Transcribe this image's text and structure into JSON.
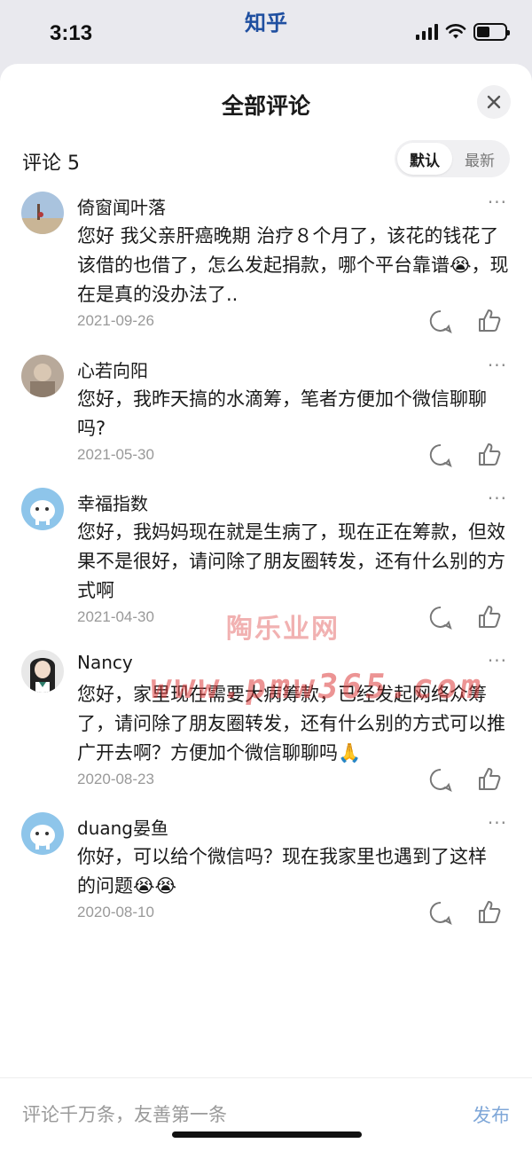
{
  "status_bar": {
    "time": "3:13",
    "app_name": "知乎",
    "battery_level": 0.45
  },
  "sheet": {
    "title": "全部评论",
    "close_icon": "close-icon",
    "comment_count_label": "评论 5",
    "sort_options": [
      "默认",
      "最新"
    ],
    "sort_selected": "默认"
  },
  "comments": [
    {
      "user": "倚窗闻叶落",
      "text": "您好 我父亲肝癌晚期 治疗８个月了，该花的钱花了该借的也借了，怎么发起捐款，哪个平台靠谱😭，现在是真的没办法了..",
      "date": "2021-09-26"
    },
    {
      "user": "心若向阳",
      "text": "您好，我昨天搞的水滴筹，笔者方便加个微信聊聊吗?",
      "date": "2021-05-30"
    },
    {
      "user": "幸福指数",
      "text": "您好，我妈妈现在就是生病了，现在正在筹款，但效果不是很好，请问除了朋友圈转发，还有什么别的方式啊",
      "date": "2021-04-30"
    },
    {
      "user": "Nancy",
      "text": "您好，家里现在需要大病筹款，已经发起网络众筹了，请问除了朋友圈转发，还有什么别的方式可以推广开去啊？方便加个微信聊聊吗🙏",
      "date": "2020-08-23"
    },
    {
      "user": "duang晏鱼",
      "text": "你好，可以给个微信吗？现在我家里也遇到了这样的问题😭😭",
      "date": "2020-08-10"
    }
  ],
  "more_label": "···",
  "watermark": {
    "cn": "陶乐业网",
    "url": "www.pmw365.com"
  },
  "bottom_bar": {
    "input_placeholder": "评论千万条，友善第一条",
    "publish_label": "发布"
  },
  "colors": {
    "accent": "#7fa7d8",
    "app_title": "#1f4fa0",
    "watermark": "#dc3c3c"
  }
}
